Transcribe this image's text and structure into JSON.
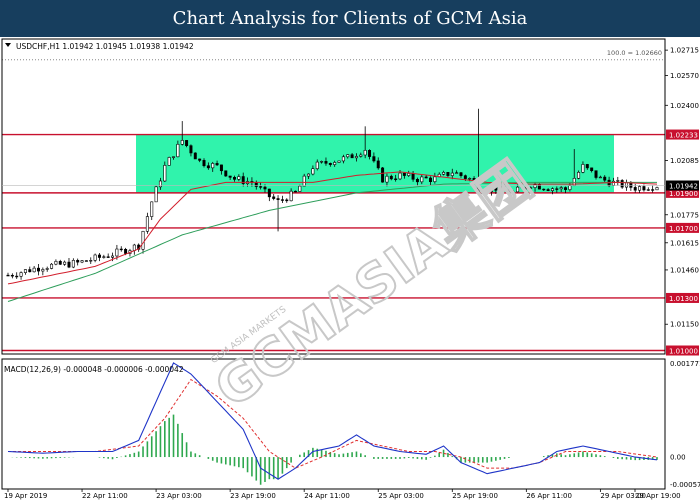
{
  "banner": {
    "title": "Chart Analysis for Clients of GCM Asia"
  },
  "watermark": {
    "text": "GCMASIA集团",
    "subtext": "GCM ASIA MARKETS"
  },
  "colors": {
    "banner_bg": "#173e5e",
    "zone_fill": "#19f2a3",
    "level_line": "#c8102e",
    "ma_fast": "#d21e2c",
    "ma_slow": "#2e9e5b",
    "macd_main": "#1f35c8",
    "macd_signal": "#e03030",
    "macd_hist": "#2fa84f"
  },
  "chart_data": {
    "type": "candlestick",
    "symbol_header": "USDCHF,H1  1.01942 1.01945 1.01938 1.01942",
    "fib_label": "100.0 = 1.02660",
    "x_tick_labels": [
      "19 Apr 2019",
      "22 Apr 11:00",
      "23 Apr 03:00",
      "23 Apr 19:00",
      "24 Apr 11:00",
      "25 Apr 03:00",
      "25 Apr 19:00",
      "26 Apr 11:00",
      "29 Apr 03:00",
      "29 Apr 19:00"
    ],
    "y_tick_labels": [
      "1.02715",
      "1.02570",
      "1.02400",
      "1.02233",
      "1.02085",
      "1.01942",
      "1.01900",
      "1.01775",
      "1.01700",
      "1.01615",
      "1.01460",
      "1.01300",
      "1.01150",
      "1.01000"
    ],
    "ylim": [
      1.0098,
      1.0275
    ],
    "zone": {
      "top": 1.02233,
      "bottom": 1.019
    },
    "levels": [
      1.02233,
      1.019,
      1.017,
      1.013,
      1.01
    ],
    "level_labels": [
      "1.02233",
      "1.01900",
      "1.01700",
      "1.01300",
      "1.01000"
    ],
    "fib_level": 1.0266,
    "current_price": 1.01942,
    "current_label": "1.01942",
    "bar_count": 150,
    "key_prices": [
      [
        0,
        1.0143
      ],
      [
        8,
        1.0148
      ],
      [
        16,
        1.015
      ],
      [
        24,
        1.0155
      ],
      [
        30,
        1.016
      ],
      [
        33,
        1.0185
      ],
      [
        36,
        1.0205
      ],
      [
        40,
        1.022
      ],
      [
        44,
        1.0208
      ],
      [
        48,
        1.0205
      ],
      [
        52,
        1.0198
      ],
      [
        56,
        1.0196
      ],
      [
        60,
        1.0188
      ],
      [
        62,
        1.0185
      ],
      [
        66,
        1.019
      ],
      [
        70,
        1.0205
      ],
      [
        74,
        1.0208
      ],
      [
        78,
        1.021
      ],
      [
        82,
        1.0215
      ],
      [
        86,
        1.0198
      ],
      [
        90,
        1.02
      ],
      [
        94,
        1.0198
      ],
      [
        98,
        1.0198
      ],
      [
        102,
        1.0202
      ],
      [
        106,
        1.0198
      ],
      [
        108,
        1.0192
      ],
      [
        112,
        1.0193
      ],
      [
        116,
        1.019
      ],
      [
        120,
        1.0195
      ],
      [
        124,
        1.0193
      ],
      [
        128,
        1.0192
      ],
      [
        132,
        1.0205
      ],
      [
        136,
        1.0198
      ],
      [
        140,
        1.0195
      ],
      [
        144,
        1.0193
      ],
      [
        149,
        1.01942
      ]
    ],
    "ma_fast_points": [
      [
        0,
        1.0138
      ],
      [
        20,
        1.0148
      ],
      [
        30,
        1.0158
      ],
      [
        35,
        1.0175
      ],
      [
        42,
        1.0192
      ],
      [
        50,
        1.0196
      ],
      [
        60,
        1.0196
      ],
      [
        70,
        1.0196
      ],
      [
        80,
        1.02
      ],
      [
        90,
        1.0202
      ],
      [
        100,
        1.0199
      ],
      [
        110,
        1.0196
      ],
      [
        120,
        1.0195
      ],
      [
        130,
        1.0195
      ],
      [
        140,
        1.0196
      ],
      [
        149,
        1.0195
      ]
    ],
    "ma_slow_points": [
      [
        0,
        1.0128
      ],
      [
        20,
        1.0144
      ],
      [
        40,
        1.0166
      ],
      [
        60,
        1.018
      ],
      [
        80,
        1.019
      ],
      [
        100,
        1.0195
      ],
      [
        120,
        1.0196
      ],
      [
        149,
        1.0196
      ]
    ],
    "macd": {
      "header": "MACD(12,26,9) -0.000048 -0.000006 -0.000042",
      "y_tick_labels": [
        "0.001771",
        "0.00",
        "-0.000577"
      ],
      "ylim": [
        -0.000577,
        0.001771
      ],
      "main_points": [
        [
          0,
          0.0001
        ],
        [
          8,
          7e-05
        ],
        [
          16,
          0.0001
        ],
        [
          24,
          0.0001
        ],
        [
          30,
          0.0003
        ],
        [
          34,
          0.001
        ],
        [
          38,
          0.0017
        ],
        [
          42,
          0.0015
        ],
        [
          48,
          0.001
        ],
        [
          54,
          0.0005
        ],
        [
          58,
          -0.0002
        ],
        [
          62,
          -0.0004
        ],
        [
          66,
          -0.0002
        ],
        [
          70,
          0.0001
        ],
        [
          76,
          0.0002
        ],
        [
          80,
          0.0004
        ],
        [
          84,
          0.0002
        ],
        [
          90,
          0.0001
        ],
        [
          96,
          5e-05
        ],
        [
          100,
          0.0002
        ],
        [
          104,
          -0.0001
        ],
        [
          110,
          -0.0003
        ],
        [
          116,
          -0.0002
        ],
        [
          122,
          -0.0001
        ],
        [
          126,
          0.0001
        ],
        [
          132,
          0.0002
        ],
        [
          138,
          0.0001
        ],
        [
          144,
          0.0
        ],
        [
          149,
          -5e-05
        ]
      ],
      "signal_points": [
        [
          0,
          0.0001
        ],
        [
          10,
          0.0001
        ],
        [
          20,
          0.0001
        ],
        [
          30,
          0.0002
        ],
        [
          36,
          0.0007
        ],
        [
          42,
          0.0014
        ],
        [
          48,
          0.0011
        ],
        [
          54,
          0.0007
        ],
        [
          60,
          0.0001
        ],
        [
          66,
          -0.0002
        ],
        [
          72,
          0.0
        ],
        [
          80,
          0.0003
        ],
        [
          86,
          0.0002
        ],
        [
          92,
          0.0001
        ],
        [
          98,
          0.0001
        ],
        [
          104,
          0.0
        ],
        [
          110,
          -0.0002
        ],
        [
          116,
          -0.0002
        ],
        [
          122,
          -0.0001
        ],
        [
          128,
          0.0001
        ],
        [
          134,
          0.0001
        ],
        [
          140,
          0.0001
        ],
        [
          149,
          0.0
        ]
      ]
    }
  }
}
